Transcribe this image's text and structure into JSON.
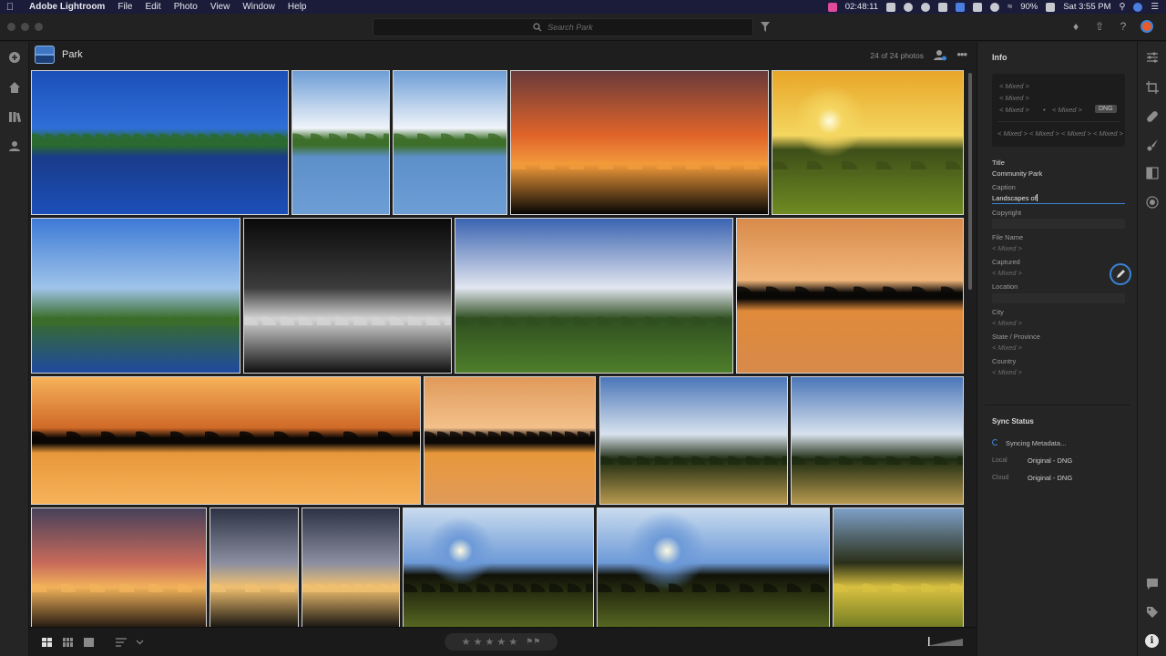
{
  "menubar": {
    "apple_icon": "apple-logo",
    "app_name": "Adobe Lightroom",
    "menus": [
      "File",
      "Edit",
      "Photo",
      "View",
      "Window",
      "Help"
    ],
    "clock": "02:48:11",
    "battery": "90%",
    "datetime": "Sat 3:55 PM"
  },
  "toolbar": {
    "search_placeholder": "Search Park"
  },
  "album": {
    "title": "Park",
    "count": "24 of 24 photos"
  },
  "photos": [
    {
      "scene": "lake-reflection-blue",
      "colors": [
        "#1b4fb8",
        "#2f6fd8",
        "#2a6a30",
        "#1a3b8a"
      ]
    },
    {
      "scene": "clouds-trees-reflection",
      "colors": [
        "#6e9ed6",
        "#f0f4fa",
        "#3d6f2a",
        "#5d8fc8"
      ]
    },
    {
      "scene": "clouds-trees-reflection",
      "colors": [
        "#6e9ed6",
        "#f0f4fa",
        "#3d6f2a",
        "#5d8fc8"
      ]
    },
    {
      "scene": "orange-sunset-silhouette",
      "colors": [
        "#6a3a3a",
        "#e0642a",
        "#f29a3a",
        "#050505"
      ]
    },
    {
      "scene": "sun-over-lake",
      "colors": [
        "#f4d660",
        "#e8a628",
        "#3e4f18",
        "#6f8b22"
      ]
    },
    {
      "scene": "trees-lake-blue",
      "colors": [
        "#3d7ad6",
        "#9fc4ea",
        "#3a6d2a",
        "#1e4aa0"
      ]
    },
    {
      "scene": "storm-cloud-bw",
      "colors": [
        "#0a0a0a",
        "#3c3c3c",
        "#d4d4d4",
        "#101010"
      ]
    },
    {
      "scene": "field-clouds",
      "colors": [
        "#3a63b0",
        "#e2e6f0",
        "#2f4f20",
        "#4e7e2a"
      ]
    },
    {
      "scene": "sunset-reflection",
      "colors": [
        "#d88a4a",
        "#f1b67a",
        "#0a0806",
        "#e08a3a"
      ]
    },
    {
      "scene": "wide-sunset-reflection",
      "colors": [
        "#f6b25a",
        "#d06a28",
        "#090604",
        "#e8983a"
      ]
    },
    {
      "scene": "sunset-reflection-2",
      "colors": [
        "#e09a5a",
        "#f3c08a",
        "#0c0806",
        "#e8983a"
      ]
    },
    {
      "scene": "tall-grass-sky",
      "colors": [
        "#4a76b8",
        "#d8e2ee",
        "#1d2a10",
        "#b89a50"
      ]
    },
    {
      "scene": "tall-grass-sky",
      "colors": [
        "#4a76b8",
        "#d8e2ee",
        "#1d2a10",
        "#b89a50"
      ]
    },
    {
      "scene": "dramatic-sunset-clouds",
      "colors": [
        "#46405a",
        "#c86a5a",
        "#f2b25a",
        "#1a120e"
      ]
    },
    {
      "scene": "fence-sunset",
      "colors": [
        "#2c3244",
        "#8a8ea0",
        "#f0c070",
        "#0c0c0c"
      ]
    },
    {
      "scene": "fence-sunset",
      "colors": [
        "#2c3244",
        "#8a8ea0",
        "#f0c070",
        "#0c0c0c"
      ]
    },
    {
      "scene": "tree-sunburst",
      "colors": [
        "#6d9ad8",
        "#c9dbee",
        "#101208",
        "#5a6a22"
      ]
    },
    {
      "scene": "tree-sunburst-wide",
      "colors": [
        "#6d9ad8",
        "#c9dbee",
        "#101208",
        "#5a6a22"
      ]
    },
    {
      "scene": "backlit-trees",
      "colors": [
        "#7ea0c8",
        "#2a2f18",
        "#d8c040",
        "#6f7a22"
      ]
    }
  ],
  "info_panel": {
    "header": "Info",
    "exif": {
      "row1": "< Mixed >",
      "row2": "< Mixed >",
      "row3a": "< Mixed >",
      "row3b": "•",
      "row3c": "< Mixed >",
      "badge": "DNG",
      "bottom": [
        "< Mixed >",
        "< Mixed >",
        "< Mixed >",
        "< Mixed >"
      ]
    },
    "title_label": "Title",
    "title_value": "Community Park",
    "caption_label": "Caption",
    "caption_value": "Landscapes of",
    "copyright_label": "Copyright",
    "filename_label": "File Name",
    "filename_value": "< Mixed >",
    "captured_label": "Captured",
    "captured_value": "< Mixed >",
    "location_label": "Location",
    "city_label": "City",
    "city_value": "< Mixed >",
    "state_label": "State / Province",
    "state_value": "< Mixed >",
    "country_label": "Country",
    "country_value": "< Mixed >"
  },
  "sync": {
    "header": "Sync Status",
    "message": "Syncing Metadata...",
    "local_label": "Local",
    "local_value": "Original - DNG",
    "cloud_label": "Cloud",
    "cloud_value": "Original - DNG"
  },
  "bottombar": {
    "stars": "★ ★ ★ ★ ★",
    "flags": "⚑⚑"
  },
  "rightrail_icons": [
    "edit-sliders-icon",
    "crop-icon",
    "healing-icon",
    "brush-icon",
    "linear-gradient-icon",
    "radial-gradient-icon",
    "comment-icon",
    "tag-icon",
    "info-icon"
  ],
  "rightrail_info_glyph": "i"
}
